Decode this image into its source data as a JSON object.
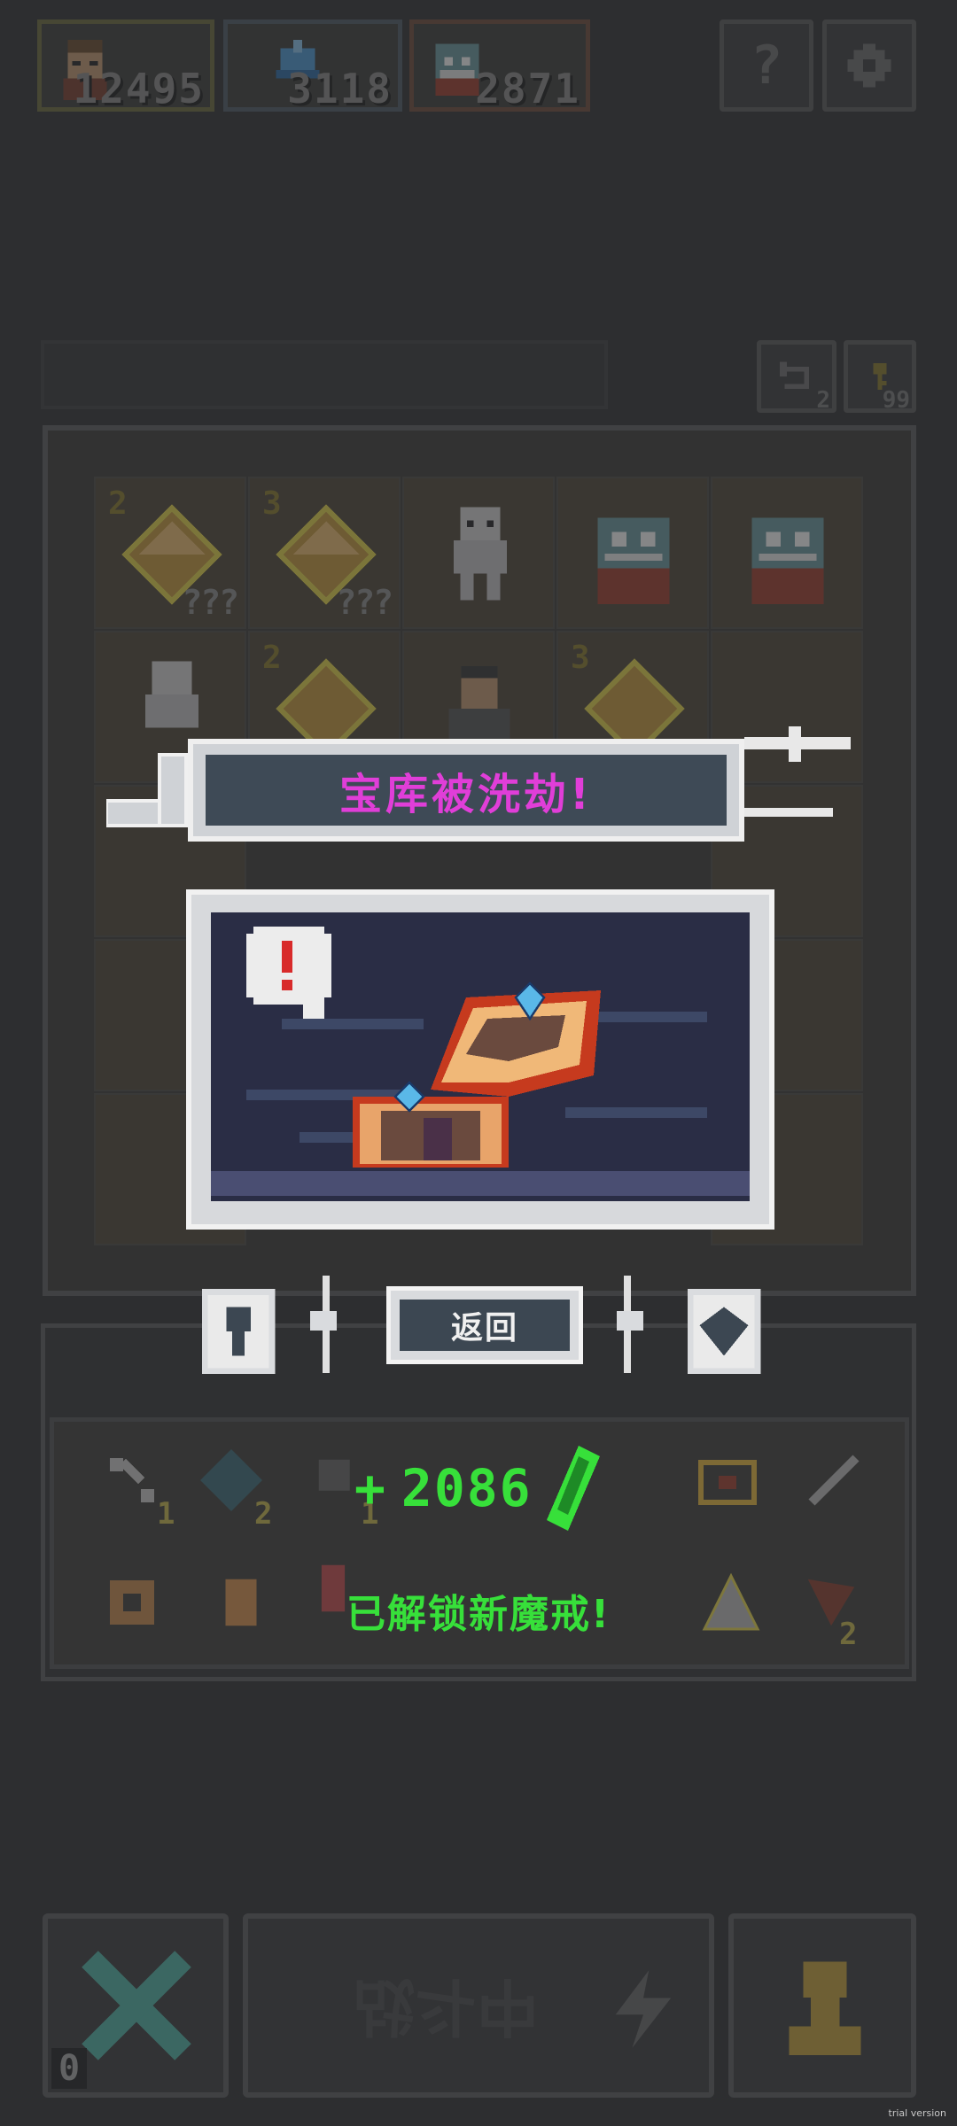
{
  "resources": [
    {
      "name": "warrior",
      "value": "12495",
      "border": "#6b6a3a",
      "icon": "warrior-portrait-icon"
    },
    {
      "name": "helmet",
      "value": "3118",
      "border": "#4e5a66",
      "icon": "helmet-icon"
    },
    {
      "name": "monster",
      "value": "2871",
      "border": "#6e4a38",
      "icon": "monster-portrait-icon"
    }
  ],
  "top_buttons": {
    "help_label": "?",
    "settings_icon": "gear-icon"
  },
  "counters": {
    "undo_count": "2",
    "key_count": "99"
  },
  "grid": {
    "cells": [
      {
        "type": "crystal",
        "level": "2",
        "mark": "???"
      },
      {
        "type": "crystal",
        "level": "3",
        "mark": "???"
      },
      {
        "type": "skeleton",
        "level": "",
        "mark": ""
      },
      {
        "type": "ogre",
        "level": "",
        "mark": ""
      },
      {
        "type": "ogre",
        "level": "",
        "mark": ""
      },
      {
        "type": "skeleton",
        "level": "",
        "mark": ""
      },
      {
        "type": "crystal",
        "level": "2",
        "mark": ""
      },
      {
        "type": "villager",
        "level": "",
        "mark": ""
      },
      {
        "type": "crystal",
        "level": "3",
        "mark": ""
      },
      {
        "type": "empty",
        "level": "",
        "mark": ""
      }
    ]
  },
  "popup": {
    "title": "宝库被洗劫!",
    "back_label": "返回",
    "title_color": "#e03ed8"
  },
  "reward": {
    "prefix": "+",
    "amount": "2086",
    "icon": "green-crystal-icon",
    "color": "#37e03a",
    "message": "已解锁新魔戒!"
  },
  "items": [
    {
      "icon": "bone-icon",
      "count": "1"
    },
    {
      "icon": "heart-stone-icon",
      "count": "2"
    },
    {
      "icon": "axe-icon",
      "count": "1"
    },
    {
      "icon": "chest-icon",
      "count": ""
    },
    {
      "icon": "sword-icon",
      "count": ""
    },
    {
      "icon": "gear-ring-icon",
      "count": ""
    },
    {
      "icon": "scroll-icon",
      "count": ""
    },
    {
      "icon": "potion-icon",
      "count": ""
    },
    {
      "icon": "wing-icon",
      "count": ""
    },
    {
      "icon": "staff-icon",
      "count": "2"
    }
  ],
  "bottom": {
    "cancel_count": "0",
    "battle_label": "战斗中",
    "piece_icon": "pawn-icon"
  },
  "watermark": "trial version"
}
